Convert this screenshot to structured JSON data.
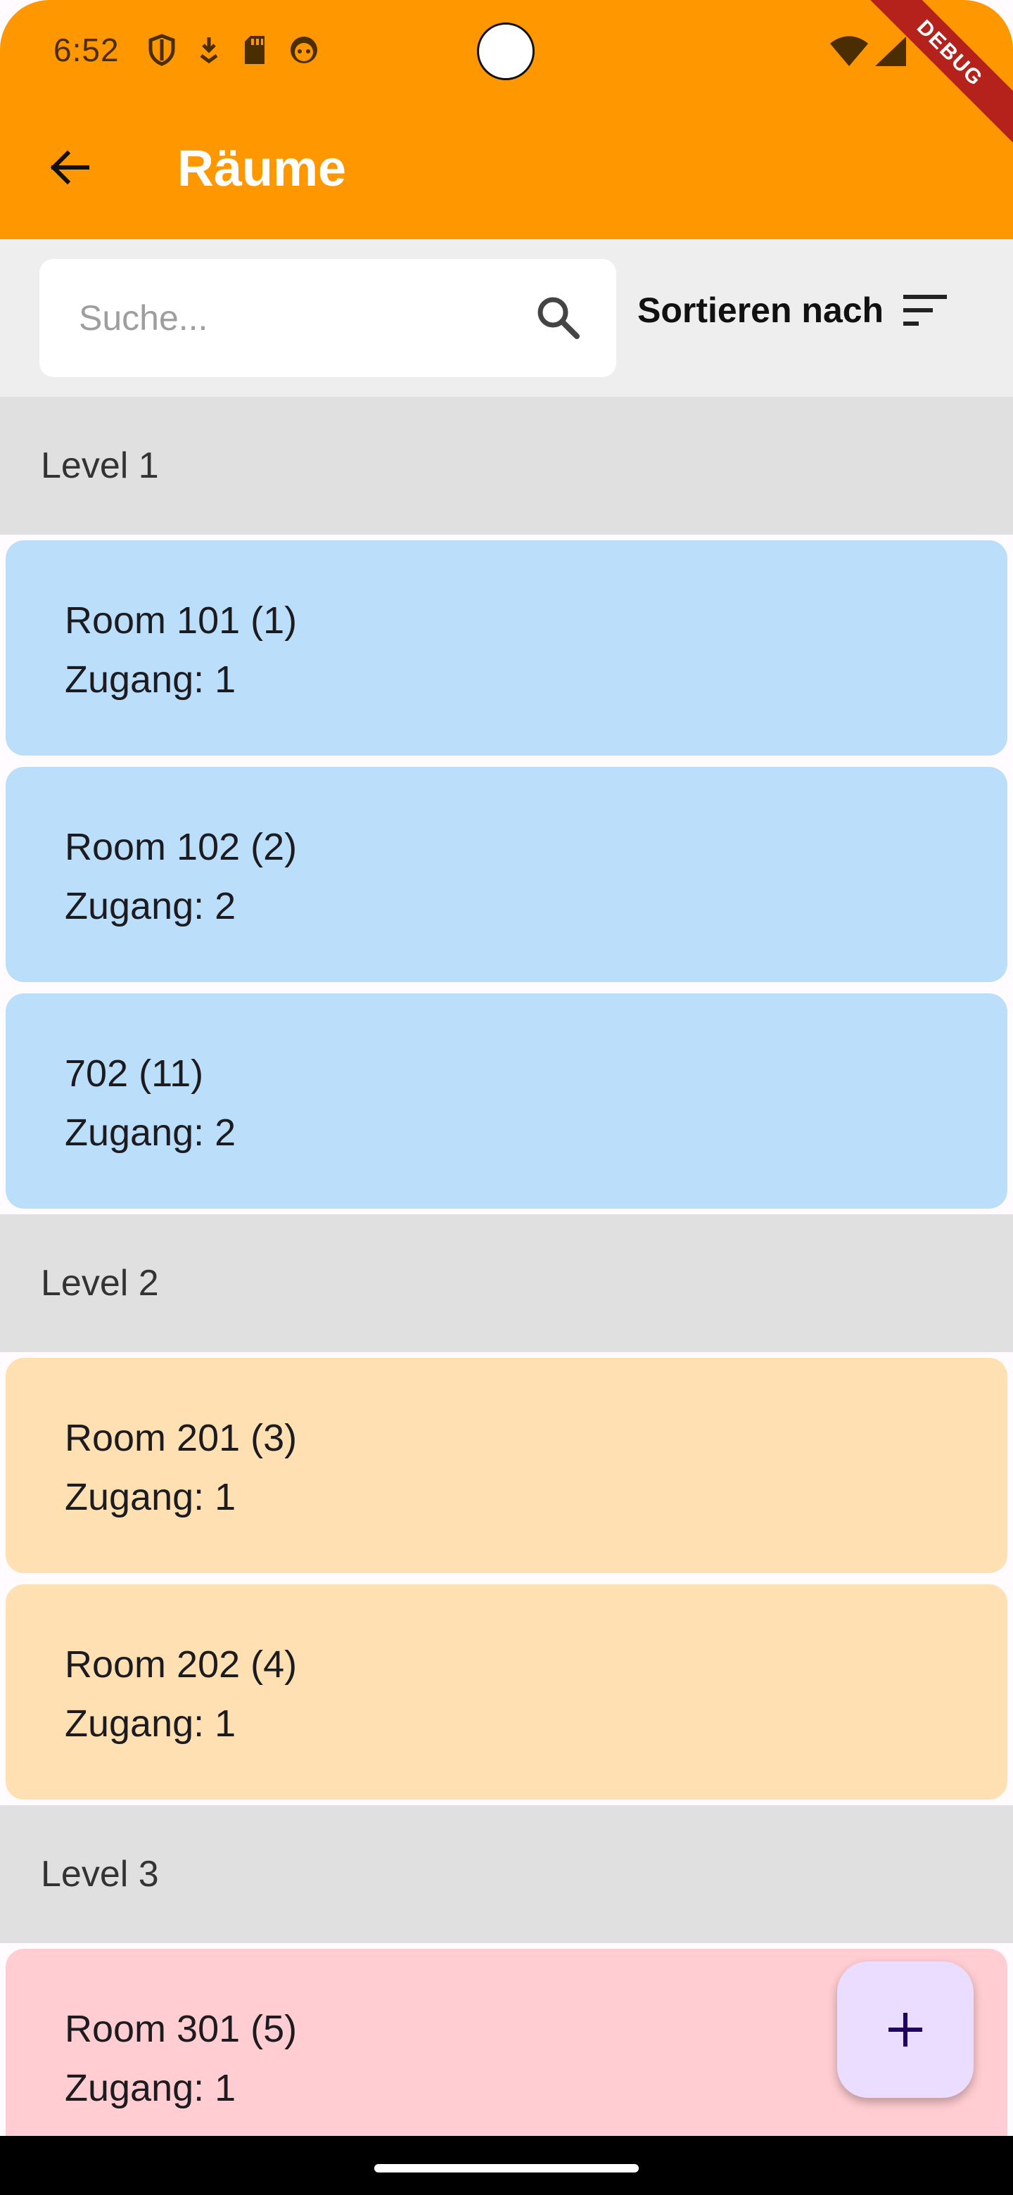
{
  "status_bar": {
    "time": "6:52",
    "left_icons": [
      "shield-icon",
      "download-icon",
      "sd-card-icon",
      "face-icon"
    ],
    "right_icons": [
      "wifi-icon",
      "cell-signal-icon"
    ]
  },
  "debug_banner": "DEBUG",
  "app_bar": {
    "title": "Räume",
    "back_icon": "arrow-back-icon",
    "background": "#ff9800"
  },
  "search": {
    "placeholder": "Suche...",
    "value": ""
  },
  "sort": {
    "label": "Sortieren nach",
    "icon": "sort-icon"
  },
  "levels": [
    {
      "title": "Level 1",
      "color": "#bbdefb",
      "rooms": [
        {
          "name": "Room 101 (1)",
          "access": "Zugang: 1"
        },
        {
          "name": "Room 102 (2)",
          "access": "Zugang: 2"
        },
        {
          "name": "702 (11)",
          "access": "Zugang: 2"
        }
      ]
    },
    {
      "title": "Level 2",
      "color": "#ffe0b2",
      "rooms": [
        {
          "name": "Room 201 (3)",
          "access": "Zugang: 1"
        },
        {
          "name": "Room 202 (4)",
          "access": "Zugang: 1"
        }
      ]
    },
    {
      "title": "Level 3",
      "color": "#ffcdd2",
      "rooms": [
        {
          "name": "Room 301 (5)",
          "access": "Zugang: 1"
        }
      ]
    }
  ],
  "fab": {
    "icon": "add-icon",
    "background": "#eaddff"
  }
}
